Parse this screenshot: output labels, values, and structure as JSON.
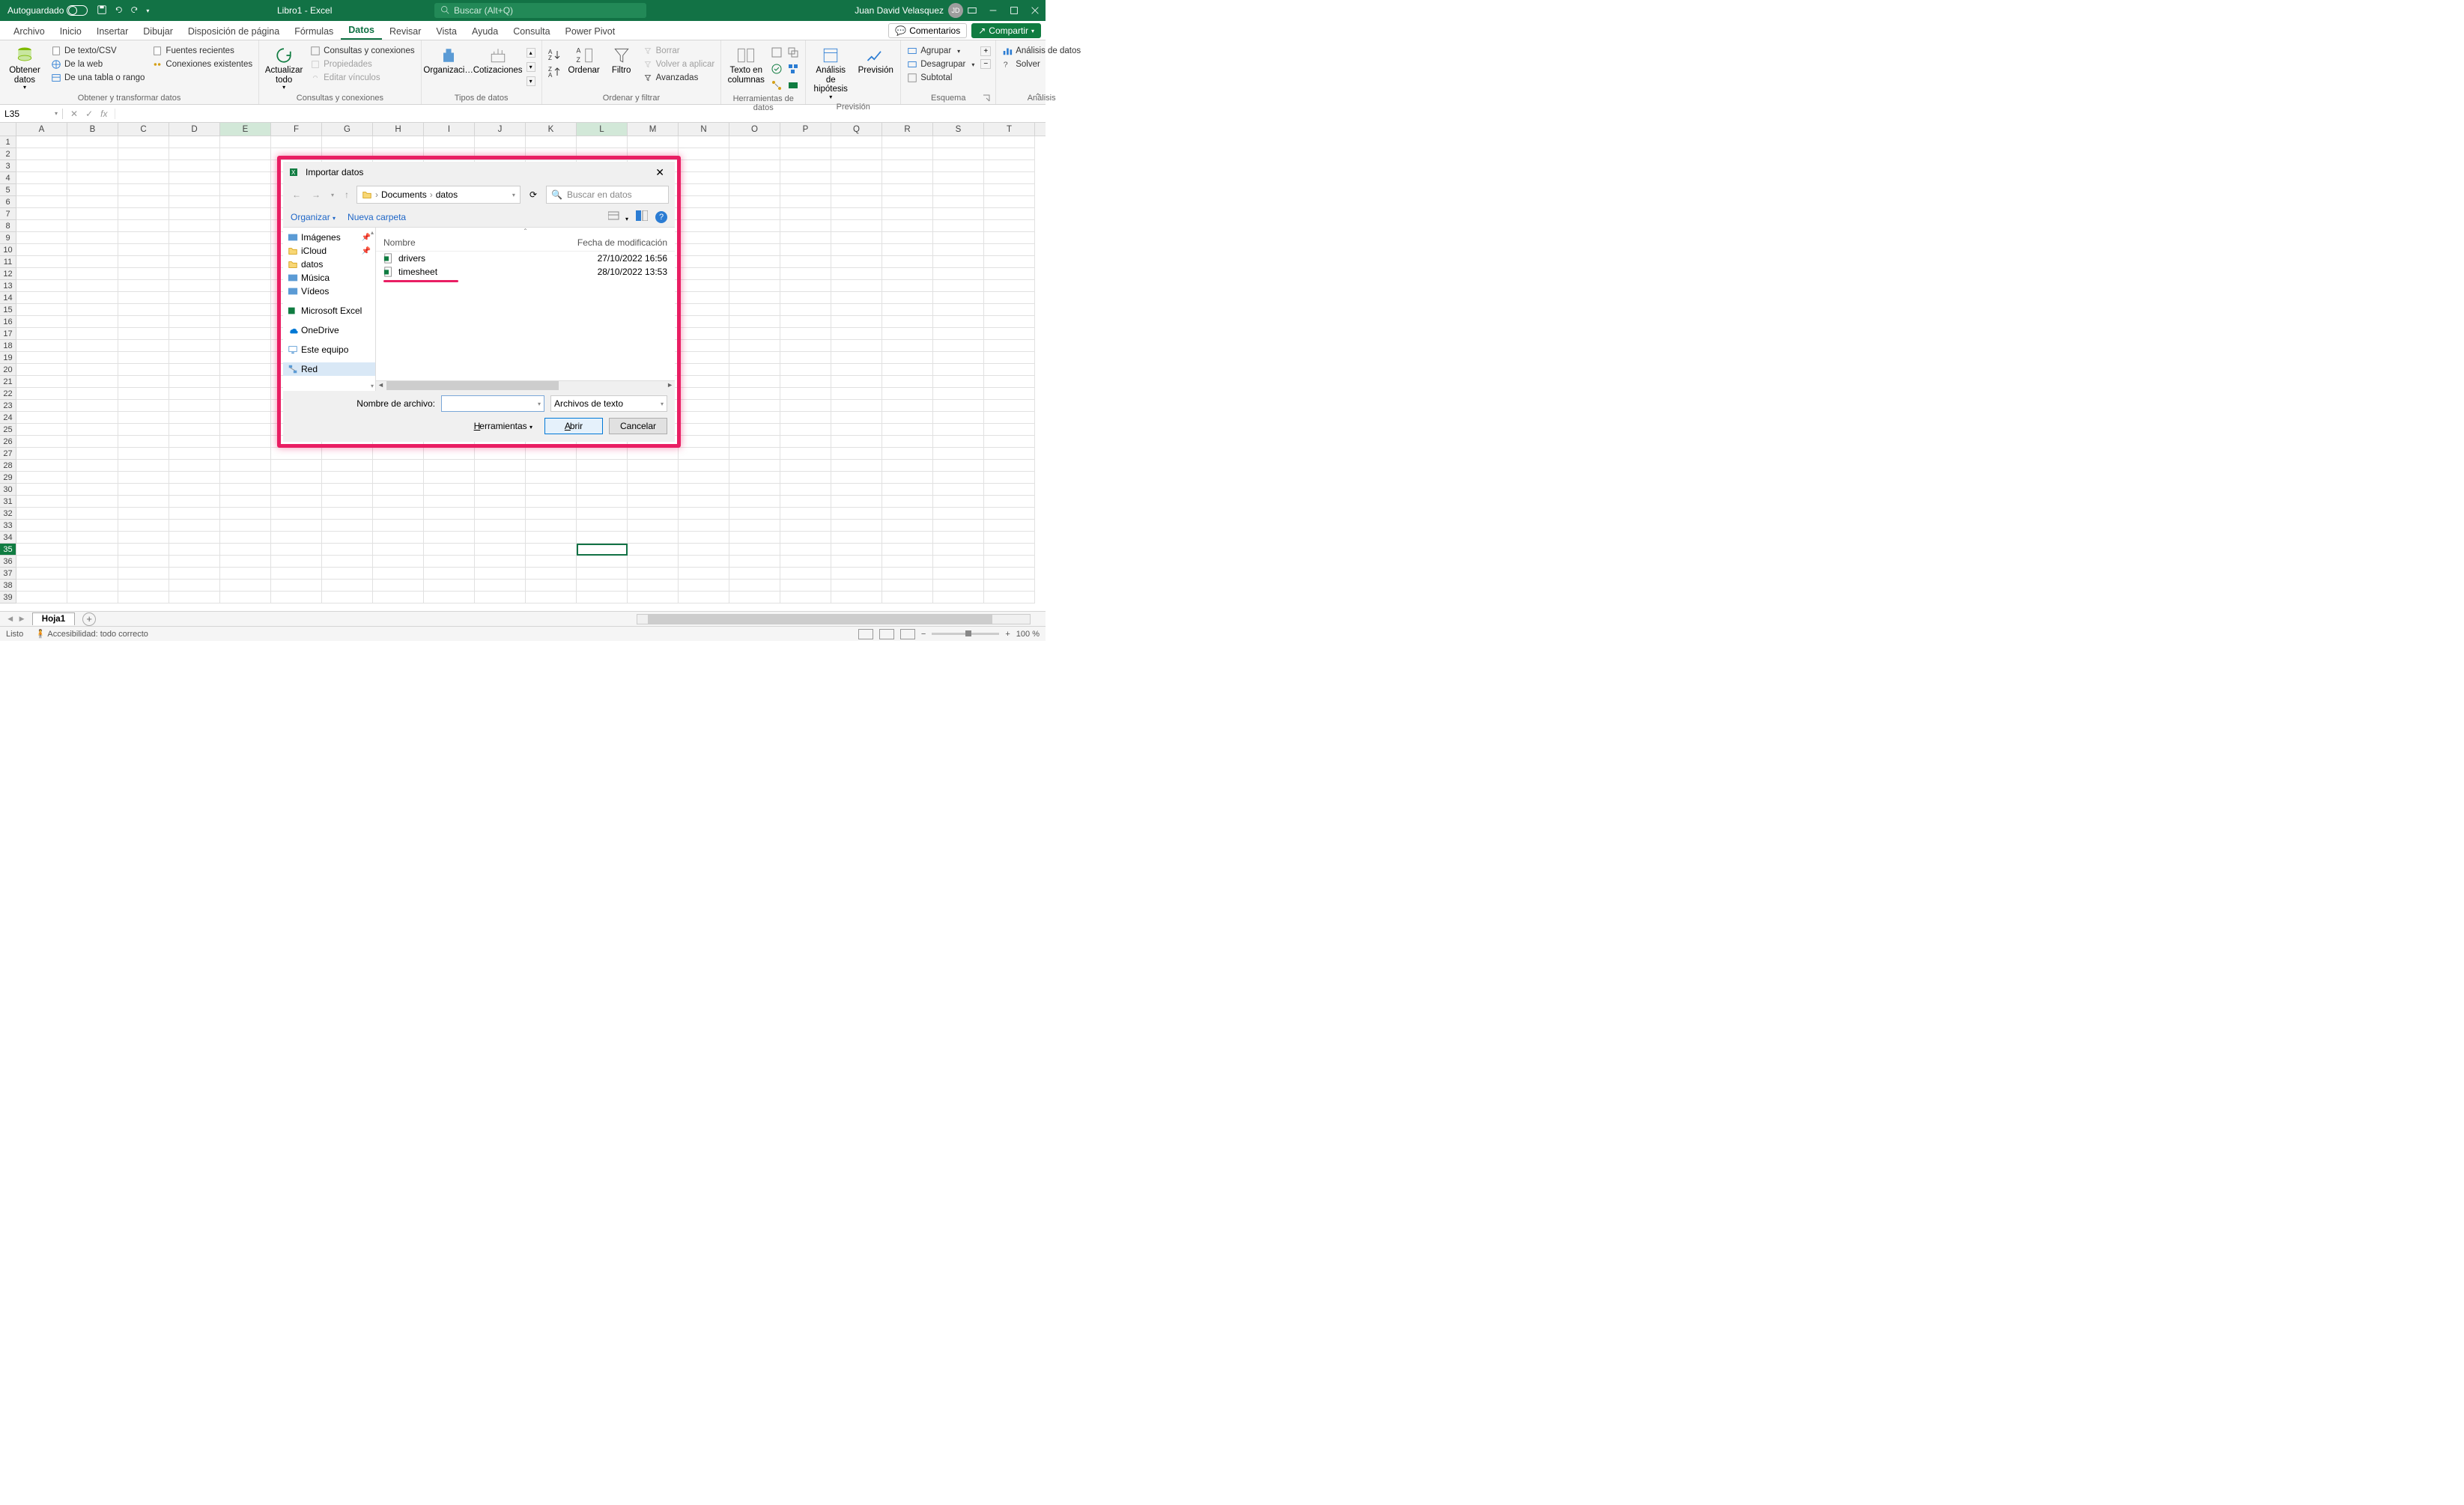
{
  "titlebar": {
    "autosave": "Autoguardado",
    "doc_title": "Libro1  -  Excel",
    "search_placeholder": "Buscar (Alt+Q)",
    "user_name": "Juan David Velasquez",
    "user_initials": "JD"
  },
  "tabs": {
    "archivo": "Archivo",
    "inicio": "Inicio",
    "insertar": "Insertar",
    "dibujar": "Dibujar",
    "disposicion": "Disposición de página",
    "formulas": "Fórmulas",
    "datos": "Datos",
    "revisar": "Revisar",
    "vista": "Vista",
    "ayuda": "Ayuda",
    "consulta": "Consulta",
    "powerpivot": "Power Pivot",
    "comentarios": "Comentarios",
    "compartir": "Compartir"
  },
  "ribbon": {
    "obtener_datos": "Obtener\ndatos",
    "texto_csv": "De texto/CSV",
    "de_la_web": "De la web",
    "de_tabla": "De una tabla o rango",
    "fuentes_recientes": "Fuentes recientes",
    "conexiones_existentes": "Conexiones existentes",
    "g_obtener": "Obtener y transformar datos",
    "actualizar_todo": "Actualizar\ntodo",
    "consultas_conexiones": "Consultas y conexiones",
    "propiedades": "Propiedades",
    "editar_vinculos": "Editar vínculos",
    "g_consultas": "Consultas y conexiones",
    "organizaci": "Organizaci…",
    "cotizaciones": "Cotizaciones",
    "g_tipos": "Tipos de datos",
    "ordenar": "Ordenar",
    "filtro": "Filtro",
    "borrar": "Borrar",
    "volver_aplicar": "Volver a aplicar",
    "avanzadas": "Avanzadas",
    "g_ordenar": "Ordenar y filtrar",
    "texto_columnas": "Texto en\ncolumnas",
    "g_herramientas": "Herramientas de datos",
    "analisis_hipotesis": "Análisis de\nhipótesis",
    "prevision": "Previsión",
    "g_prevision": "Previsión",
    "agrupar": "Agrupar",
    "desagrupar": "Desagrupar",
    "subtotal": "Subtotal",
    "g_esquema": "Esquema",
    "analisis_datos": "Análisis de datos",
    "solver": "Solver",
    "g_analisis": "Análisis"
  },
  "formulabar": {
    "namebox": "L35"
  },
  "columns": [
    "A",
    "B",
    "C",
    "D",
    "E",
    "F",
    "G",
    "H",
    "I",
    "J",
    "K",
    "L",
    "M",
    "N",
    "O",
    "P",
    "Q",
    "R",
    "S",
    "T"
  ],
  "sheettabs": {
    "hoja1": "Hoja1"
  },
  "statusbar": {
    "listo": "Listo",
    "accesibilidad": "Accesibilidad: todo correcto",
    "zoom": "100 %"
  },
  "dialog": {
    "title": "Importar datos",
    "crumb1": "Documents",
    "crumb2": "datos",
    "search_placeholder": "Buscar en datos",
    "organizar": "Organizar",
    "nueva_carpeta": "Nueva carpeta",
    "tree": {
      "imagenes": "Imágenes",
      "icloud": "iCloud",
      "datos": "datos",
      "musica": "Música",
      "videos": "Vídeos",
      "msexcel": "Microsoft Excel",
      "onedrive": "OneDrive",
      "este_equipo": "Este equipo",
      "red": "Red"
    },
    "cols": {
      "nombre": "Nombre",
      "fecha": "Fecha de modificación"
    },
    "files": [
      {
        "name": "drivers",
        "date": "27/10/2022 16:56"
      },
      {
        "name": "timesheet",
        "date": "28/10/2022 13:53"
      }
    ],
    "nombre_archivo": "Nombre de archivo:",
    "filtro_tipo": "Archivos de texto",
    "herramientas": "Herramientas",
    "abrir": "Abrir",
    "cancelar": "Cancelar"
  }
}
